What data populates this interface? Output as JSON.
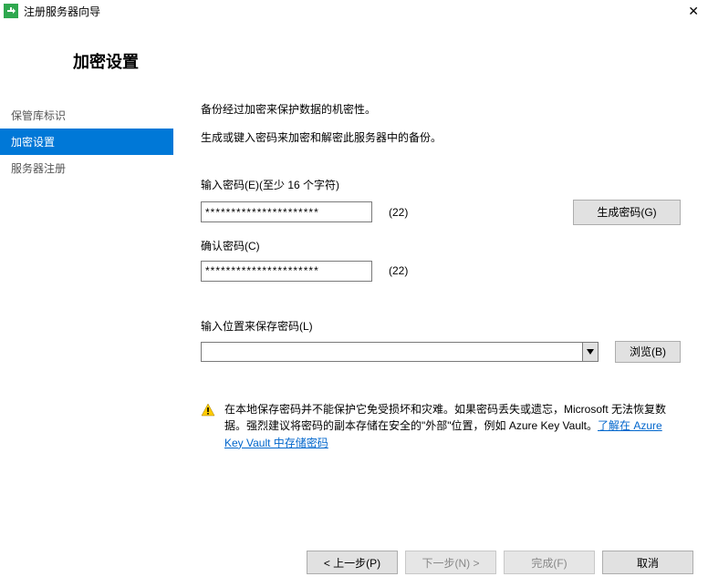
{
  "window": {
    "title": "注册服务器向导"
  },
  "header": {
    "title": "加密设置"
  },
  "sidebar": {
    "items": [
      {
        "label": "保管库标识",
        "active": false
      },
      {
        "label": "加密设置",
        "active": true
      },
      {
        "label": "服务器注册",
        "active": false
      }
    ]
  },
  "content": {
    "desc1": "备份经过加密来保护数据的机密性。",
    "desc2": "生成或键入密码来加密和解密此服务器中的备份。",
    "enterPassLabel": "输入密码(E)(至少 16 个字符)",
    "enterPassValue": "**********************",
    "enterPassCount": "(22)",
    "generateBtn": "生成密码(G)",
    "confirmPassLabel": "确认密码(C)",
    "confirmPassValue": "**********************",
    "confirmPassCount": "(22)",
    "locationLabel": "输入位置来保存密码(L)",
    "locationValue": "",
    "browseBtn": "浏览(B)",
    "warning": {
      "part1": "在本地保存密码并不能保护它免受损坏和灾难。如果密码丢失或遗忘，Microsoft 无法恢复数据。强烈建议将密码的副本存储在安全的\"外部\"位置，例如 Azure Key Vault。",
      "linkText": "了解在 Azure Key Vault 中存储密码"
    }
  },
  "footer": {
    "back": "< 上一步(P)",
    "next": "下一步(N) >",
    "finish": "完成(F)",
    "cancel": "取消"
  }
}
